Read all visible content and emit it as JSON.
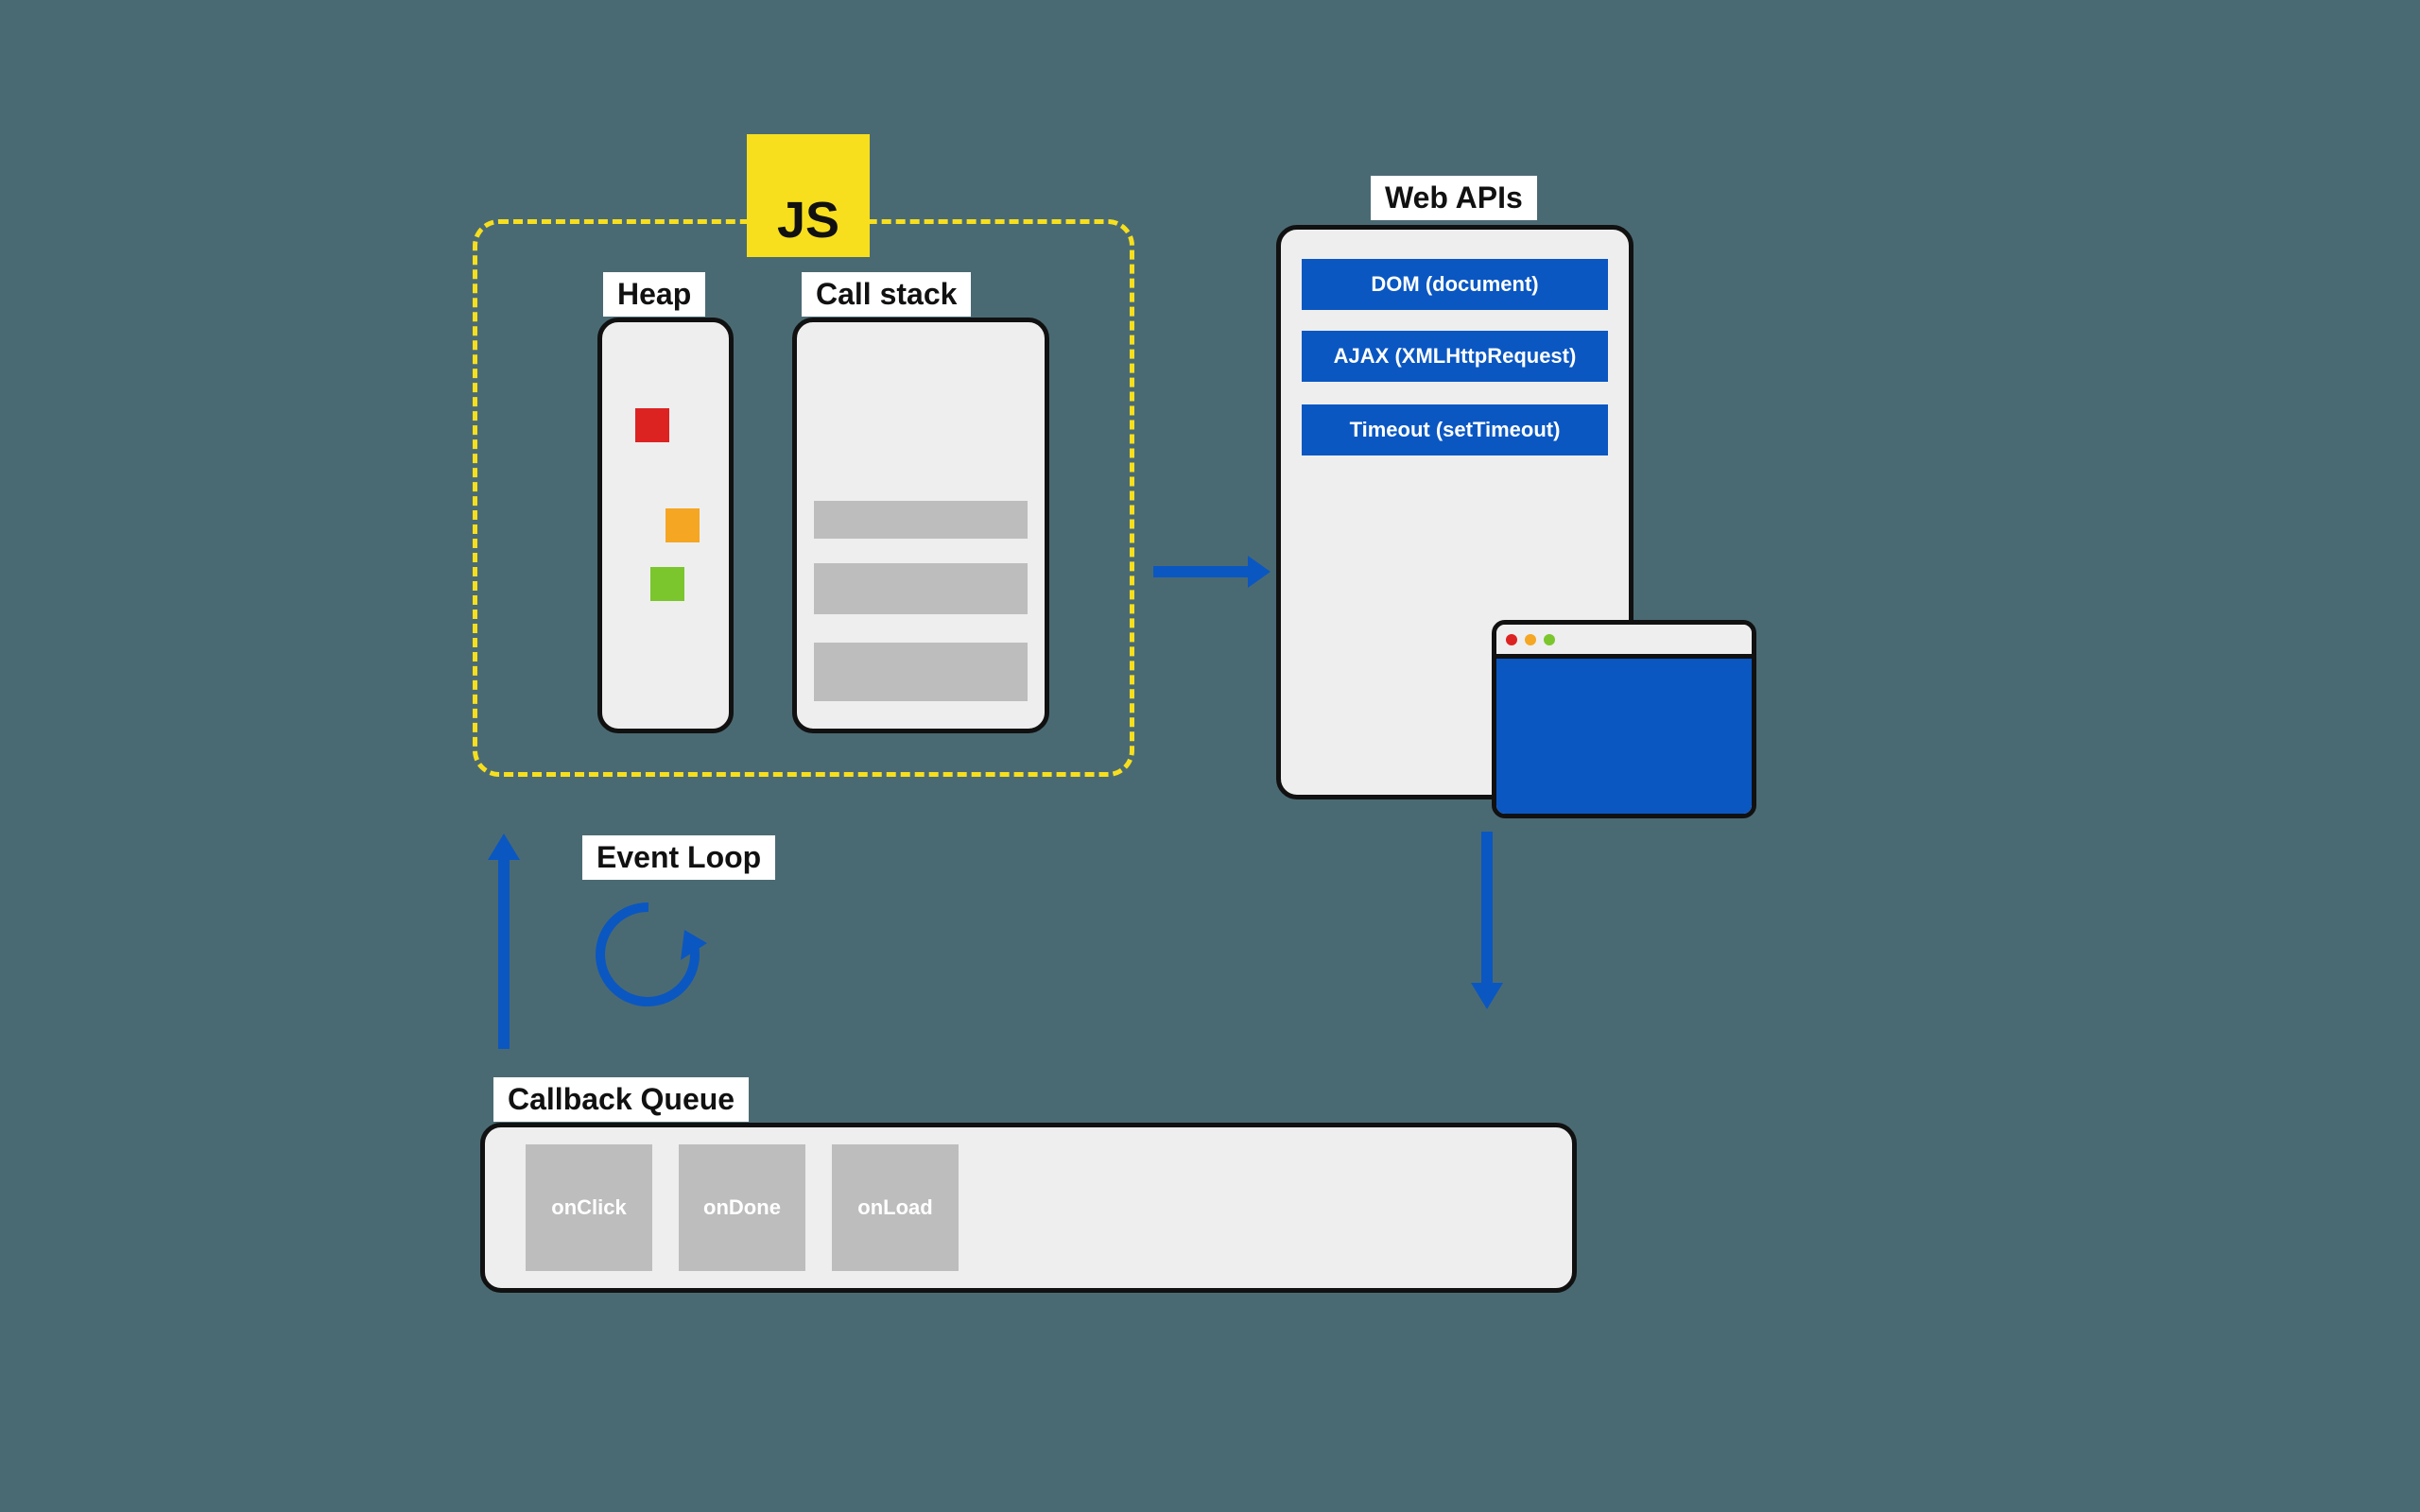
{
  "js": {
    "badge": "JS"
  },
  "heap": {
    "label": "Heap",
    "objects": [
      {
        "color": "#d22"
      },
      {
        "color": "#f5a623"
      },
      {
        "color": "#7bc62d"
      }
    ]
  },
  "callstack": {
    "label": "Call stack",
    "frames": 3
  },
  "webapis": {
    "label": "Web APIs",
    "items": [
      "DOM (document)",
      "AJAX (XMLHttpRequest)",
      "Timeout (setTimeout)"
    ]
  },
  "event_loop": {
    "label": "Event Loop"
  },
  "callback_queue": {
    "label": "Callback Queue",
    "items": [
      "onClick",
      "onDone",
      "onLoad"
    ]
  },
  "colors": {
    "accent_blue": "#0a57c2",
    "js_yellow": "#f7df1e",
    "bg": "#4a6a73"
  }
}
